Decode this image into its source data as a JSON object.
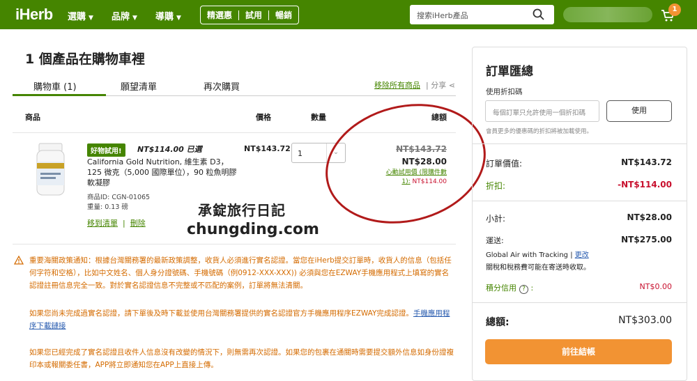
{
  "nav": {
    "logo": "iHerb",
    "links": [
      "選購",
      "品牌",
      "導購"
    ],
    "pills": [
      "精選惠",
      "試用",
      "暢銷"
    ],
    "search_placeholder": "搜索iHerb產品",
    "cart_count": "1"
  },
  "cart": {
    "heading": "1 個產品在購物車裡",
    "tabs": [
      "購物車 (1)",
      "願望清單",
      "再次購買"
    ],
    "remove_all": "移除所有商品",
    "share": "分享",
    "columns": {
      "product": "商品",
      "price": "價格",
      "qty": "數量",
      "total": "總額"
    },
    "item": {
      "free_badge": "好物試用!",
      "chosen": "NT$114.00 已選",
      "name": "California Gold Nutrition, 維生素 D3，125 微克（5,000 國際單位），90 粒魚明膠軟凝膠",
      "product_id": "商品ID: CGN-01065",
      "weight": "重量: 0.13 磅",
      "move_to_list": "移到清單",
      "delete": "刪除",
      "price": "NT$143.72",
      "qty": "1",
      "strike_total": "NT$143.72",
      "total": "NT$28.00",
      "promo_label": "心動試用價 (限購件數 1):",
      "promo_price": "NT$114.00"
    }
  },
  "watermark": {
    "line1": "承錠旅行日記",
    "line2": "chungding.com"
  },
  "notices": {
    "p1": "重要海關政策通知：根據台灣關務署的最新政策調整，收貨人必須進行實名認證。當您在iHerb提交訂單時，收貨人的信息（包括任何字符和空格），比如中文姓名、個人身分證號碼、手機號碼（例0912-XXX-XXX)) 必須與您在EZWAY手機應用程式上填寫的實名認證註冊信息完全一致。對於實名認證信息不完整或不匹配的案例，訂單將無法清關。",
    "p2": "如果您尚未完成過實名認證，請下單後及時下載並使用台灣關務署提供的實名認證官方手機應用程序EZWAY完成認證。",
    "p2_link": "手機應用程序下載鏈接",
    "p3": "如果您已經完成了實名認證且收件人信息沒有改變的情況下，則無需再次認證。如果您的包裹在通關時需要提交額外信息如身份證複印本或報關委任書，APP將立即通知您在APP上直接上傳。"
  },
  "summary": {
    "title": "訂單匯總",
    "coupon_label": "使用折扣碼",
    "coupon_placeholder": "每個訂單只允許使用一個折扣碼",
    "use_button": "使用",
    "coupon_note": "會員更多的優惠碼的折扣將被加載使用。",
    "order_value_label": "訂單價值:",
    "order_value": "NT$143.72",
    "discount_label": "折扣:",
    "discount": "-NT$114.00",
    "subtotal_label": "小計:",
    "subtotal": "NT$28.00",
    "shipping_label": "運送:",
    "shipping": "NT$275.00",
    "shipping_method": "Global Air with Tracking",
    "change": "更改",
    "tax_note": "關稅和稅務費可能在寄送時收取。",
    "credit_label": "積分信用",
    "credit": "NT$0.00",
    "total_label": "總額:",
    "total": "NT$303.00",
    "checkout": "前往結帳"
  },
  "colors": {
    "brand": "#458500",
    "accent": "#f29333",
    "red": "#c8102e",
    "notice": "#d46b00"
  }
}
